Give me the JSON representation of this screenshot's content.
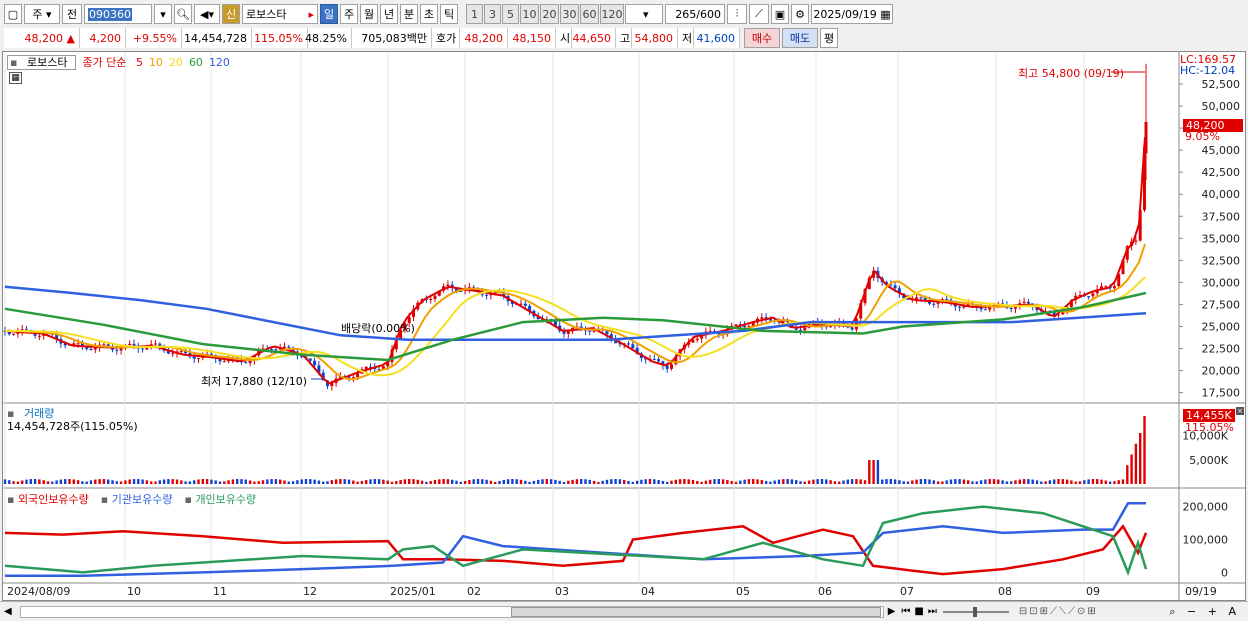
{
  "toolbar": {
    "market": "주",
    "prev": "전",
    "code": "090360",
    "shin": "신",
    "name": "로보스타",
    "periods": [
      "일",
      "주",
      "월",
      "년",
      "분",
      "초",
      "틱"
    ],
    "active_period": "일",
    "intervals": [
      "1",
      "3",
      "5",
      "10",
      "20",
      "30",
      "60",
      "120"
    ],
    "count": "265",
    "count_max": "/600",
    "date": "2025/09/19"
  },
  "quote": {
    "price": "48,200",
    "arrow": "▲",
    "change": "4,200",
    "change_pct": "+9.55%",
    "volume": "14,454,728",
    "vol_ratio": "115.05%",
    "turnover": "48.25%",
    "amount": "705,083백만",
    "hoga_label": "호가",
    "ask": "48,200",
    "bid": "48,150",
    "open_label": "시",
    "open": "44,650",
    "high_label": "고",
    "high": "54,800",
    "low_label": "저",
    "low": "41,600",
    "buy": "매수",
    "sell": "매도",
    "eval": "평"
  },
  "price_panel": {
    "stock": "로보스타",
    "ma_title": "종가 단순",
    "ma_periods": [
      "5",
      "10",
      "20",
      "60",
      "120"
    ],
    "ma_colors": [
      "#e00000",
      "#f0a000",
      "#f5e020",
      "#2a9a3a",
      "#3060e0"
    ],
    "lc_label": "LC:169.57",
    "hc_label": "HC:-12.04",
    "high_annot": "최고 54,800 (09/19)",
    "low_annot": "최저 17,880 (12/10)",
    "dividend_annot": "배당락(0.00%)",
    "current_price_tag": "48,200",
    "current_pct_tag": "9.05%",
    "y_ticks": [
      "52,500",
      "50,000",
      "47,500",
      "45,000",
      "42,500",
      "40,000",
      "37,500",
      "35,000",
      "32,500",
      "30,000",
      "27,500",
      "25,000",
      "22,500",
      "20,000",
      "17,500"
    ]
  },
  "volume_panel": {
    "title": "거래량",
    "value": "14,454,728주(115.05%)",
    "tag": "14,455K",
    "tag_pct": "115.05%",
    "y_ticks": [
      "10,000K",
      "5,000K"
    ]
  },
  "holding_panel": {
    "series": [
      "외국인보유수량",
      "기관보유수량",
      "개인보유수량"
    ],
    "colors": [
      "#e00000",
      "#3060e0",
      "#2a9a5a"
    ],
    "y_ticks": [
      "200,000",
      "100,000",
      "0"
    ]
  },
  "x_axis": {
    "labels": [
      "2024/08/09",
      "10",
      "11",
      "12",
      "2025/01",
      "02",
      "03",
      "04",
      "05",
      "06",
      "07",
      "08",
      "09"
    ],
    "right_label": "09/19"
  },
  "chart_data": {
    "type": "line",
    "series": [
      {
        "name": "종가 단순 5",
        "values": [
          24500,
          22500,
          22000,
          21000,
          18500,
          21000,
          28500,
          28000,
          24500,
          20500,
          24500,
          26500,
          25000,
          29000,
          27500,
          26000,
          36000,
          44000
        ]
      },
      {
        "name": "120",
        "values": [
          29500,
          28800,
          28000,
          27000,
          25500,
          24000,
          23500,
          23500,
          23500,
          23500,
          24000,
          24500,
          25500,
          25500,
          25500,
          25500,
          26000,
          26500
        ]
      }
    ],
    "ylim": [
      17000,
      55000
    ]
  }
}
